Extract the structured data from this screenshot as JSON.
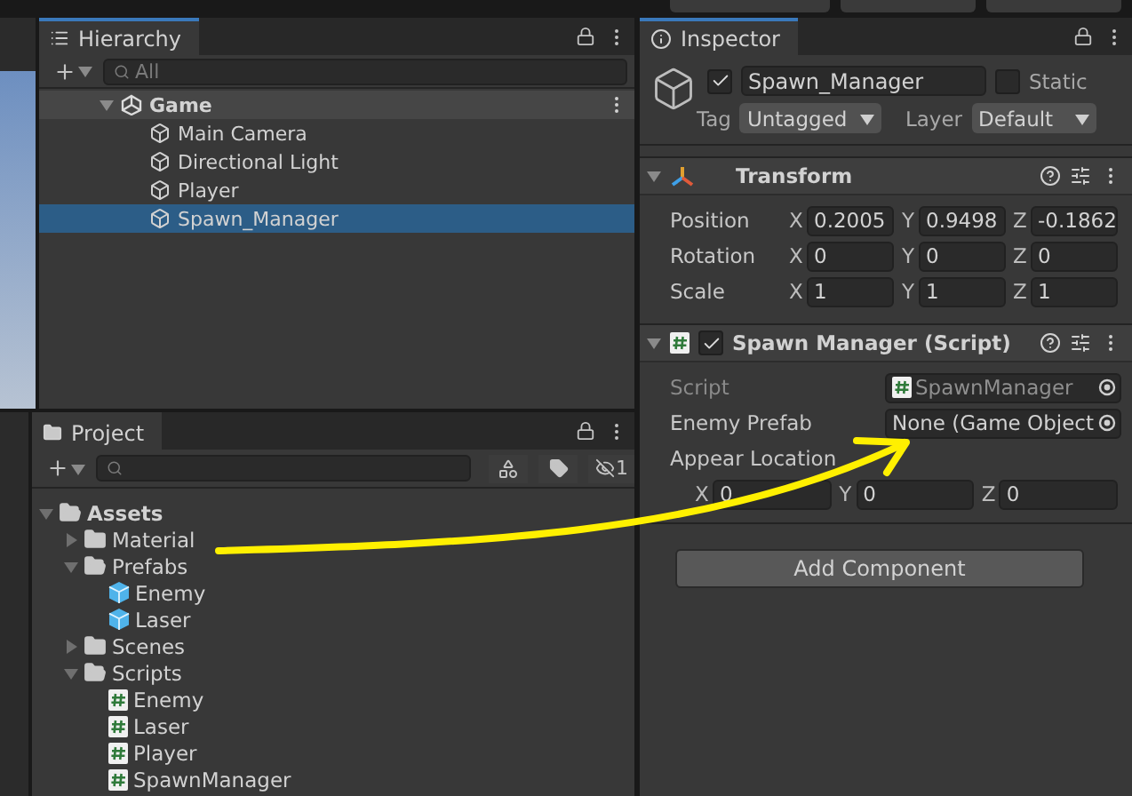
{
  "hierarchy": {
    "title": "Hierarchy",
    "search": {
      "placeholder": "All"
    },
    "scene": {
      "name": "Game",
      "expanded": true,
      "children": [
        {
          "name": "Main Camera",
          "selected": false
        },
        {
          "name": "Directional Light",
          "selected": false
        },
        {
          "name": "Player",
          "selected": false
        },
        {
          "name": "Spawn_Manager",
          "selected": true
        }
      ]
    }
  },
  "inspector": {
    "title": "Inspector",
    "object": {
      "active": true,
      "name": "Spawn_Manager",
      "static": false,
      "static_label": "Static",
      "tag_label": "Tag",
      "tag": "Untagged",
      "layer_label": "Layer",
      "layer": "Default"
    },
    "components": [
      {
        "kind": "transform",
        "name": "Transform",
        "expanded": true,
        "rows": [
          {
            "label": "Position",
            "values": [
              {
                "axis": "X",
                "value": "0.2005"
              },
              {
                "axis": "Y",
                "value": "0.9498"
              },
              {
                "axis": "Z",
                "value": "-0.1862"
              }
            ]
          },
          {
            "label": "Rotation",
            "values": [
              {
                "axis": "X",
                "value": "0"
              },
              {
                "axis": "Y",
                "value": "0"
              },
              {
                "axis": "Z",
                "value": "0"
              }
            ]
          },
          {
            "label": "Scale",
            "values": [
              {
                "axis": "X",
                "value": "1"
              },
              {
                "axis": "Y",
                "value": "1"
              },
              {
                "axis": "Z",
                "value": "1"
              }
            ]
          }
        ]
      },
      {
        "kind": "script",
        "name": "Spawn Manager (Script)",
        "enabled": true,
        "expanded": true,
        "fields": [
          {
            "kind": "script",
            "label": "Script",
            "value": "SpawnManager",
            "disabled": true
          },
          {
            "kind": "object",
            "label": "Enemy Prefab",
            "value": "None (Game Object",
            "disabled": false
          },
          {
            "kind": "vector",
            "label": "Appear Location",
            "disabled": false,
            "values": [
              {
                "axis": "X",
                "value": "0"
              },
              {
                "axis": "Y",
                "value": "0"
              },
              {
                "axis": "Z",
                "value": "0"
              }
            ]
          }
        ]
      }
    ],
    "add_component": "Add Component"
  },
  "project": {
    "title": "Project",
    "hidden_count": "1",
    "tree": [
      {
        "name": "Assets",
        "kind": "folder",
        "expanded": true,
        "children": [
          {
            "name": "Material",
            "kind": "folder",
            "expanded": false
          },
          {
            "name": "Prefabs",
            "kind": "folder",
            "expanded": true,
            "children": [
              {
                "name": "Enemy",
                "kind": "prefab"
              },
              {
                "name": "Laser",
                "kind": "prefab"
              }
            ]
          },
          {
            "name": "Scenes",
            "kind": "folder",
            "expanded": false
          },
          {
            "name": "Scripts",
            "kind": "folder",
            "expanded": true,
            "children": [
              {
                "name": "Enemy",
                "kind": "script"
              },
              {
                "name": "Laser",
                "kind": "script"
              },
              {
                "name": "Player",
                "kind": "script"
              },
              {
                "name": "SpawnManager",
                "kind": "script"
              }
            ]
          }
        ]
      }
    ]
  }
}
